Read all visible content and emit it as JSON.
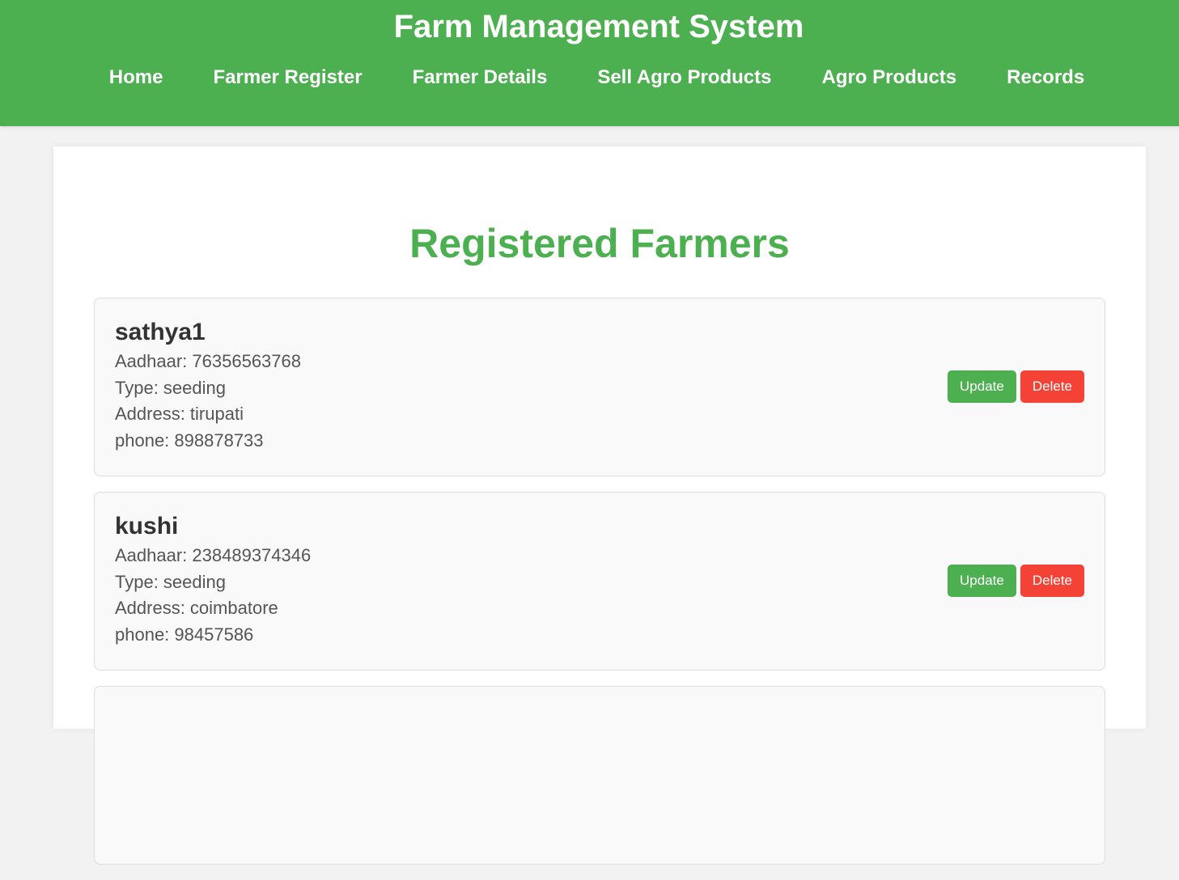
{
  "header": {
    "title": "Farm Management System",
    "nav": [
      "Home",
      "Farmer Register",
      "Farmer Details",
      "Sell Agro Products",
      "Agro Products",
      "Records"
    ]
  },
  "main": {
    "heading": "Registered Farmers",
    "farmers": [
      {
        "name": "sathya1",
        "aadhaar": "Aadhaar: 76356563768",
        "type": "Type: seeding",
        "address": "Address: tirupati",
        "phone": "phone: 898878733",
        "update_label": "Update",
        "delete_label": "Delete"
      },
      {
        "name": "kushi",
        "aadhaar": "Aadhaar: 238489374346",
        "type": "Type: seeding",
        "address": "Address: coimbatore",
        "phone": "phone: 98457586",
        "update_label": "Update",
        "delete_label": "Delete"
      }
    ]
  },
  "colors": {
    "primary": "#4caf50",
    "danger": "#f44336",
    "background": "#f2f2f2",
    "card": "#f9f9f9"
  }
}
